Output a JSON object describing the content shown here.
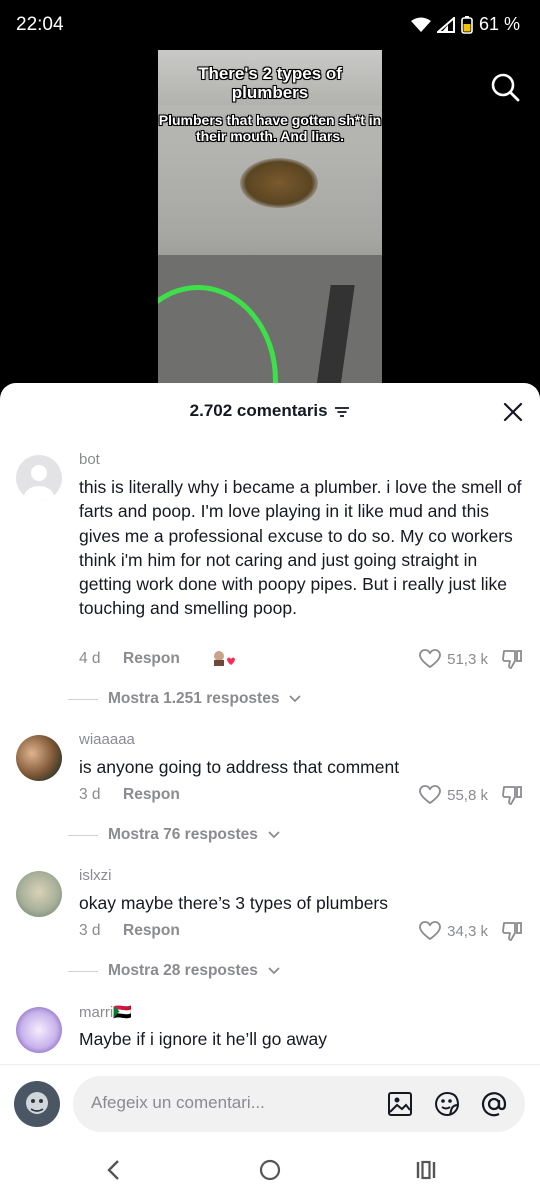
{
  "status_bar": {
    "time": "22:04",
    "battery": "61 %"
  },
  "video": {
    "caption_title": "There's 2 types of plumbers",
    "caption_body": "Plumbers that have gotten sh*t in their mouth. And liars."
  },
  "comments_sheet": {
    "count_label": "2.702 comentaris",
    "reply_label": "Respon",
    "comments": [
      {
        "username": "bot",
        "text": "this is literally why i became a plumber. i love the smell of farts and poop. I'm love playing in it like mud and this gives me a professional excuse to do so. My co workers think i'm him for not caring and just going straight in getting work done with poopy pipes. But i really just like touching and smelling poop.",
        "age": "4 d",
        "likes": "51,3 k",
        "replies": "Mostra 1.251 respostes"
      },
      {
        "username": "wiaaaaa",
        "text": "is anyone going to address that comment",
        "age": "3 d",
        "likes": "55,8 k",
        "replies": "Mostra 76 respostes"
      },
      {
        "username": "islxzi",
        "text": "okay maybe there’s 3 types of plumbers",
        "age": "3 d",
        "likes": "34,3 k",
        "replies": "Mostra 28 respostes"
      },
      {
        "username": "marri🇸🇩",
        "text": "Maybe if i ignore it he’ll go away"
      }
    ]
  },
  "composer": {
    "placeholder": "Afegeix un comentari..."
  },
  "colors": {
    "text": "#161823",
    "secondary": "#8a8b91",
    "liked_heart": "#fe2c55"
  }
}
